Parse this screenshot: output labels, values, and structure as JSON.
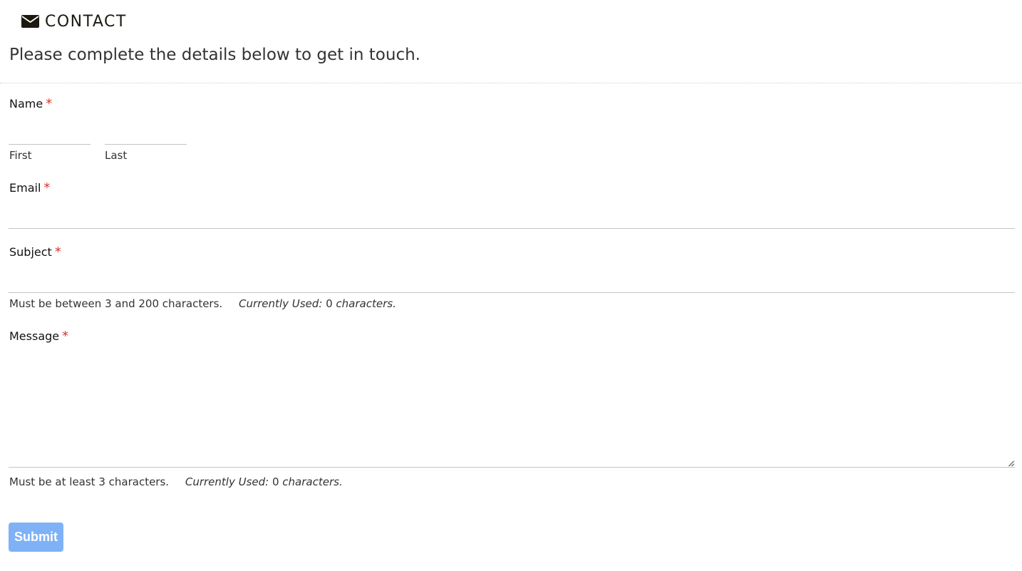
{
  "header": {
    "icon": "envelope-icon",
    "title": "CONTACT",
    "intro": "Please complete the details below to get in touch."
  },
  "form": {
    "required_marker": "*",
    "name": {
      "label": "Name",
      "first_label": "First",
      "last_label": "Last",
      "first_value": "",
      "last_value": ""
    },
    "email": {
      "label": "Email",
      "value": ""
    },
    "subject": {
      "label": "Subject",
      "value": "",
      "hint": "Must be between 3 and 200 characters.",
      "used_prefix": "Currently Used:",
      "used_count": "0",
      "used_suffix": "characters."
    },
    "message": {
      "label": "Message",
      "value": "",
      "hint": "Must be at least 3 characters.",
      "used_prefix": "Currently Used:",
      "used_count": "0",
      "used_suffix": "characters."
    },
    "submit_label": "Submit"
  },
  "colors": {
    "required": "#d9322c",
    "submit_bg": "#7fb1f7",
    "title": "#1c1a10"
  }
}
